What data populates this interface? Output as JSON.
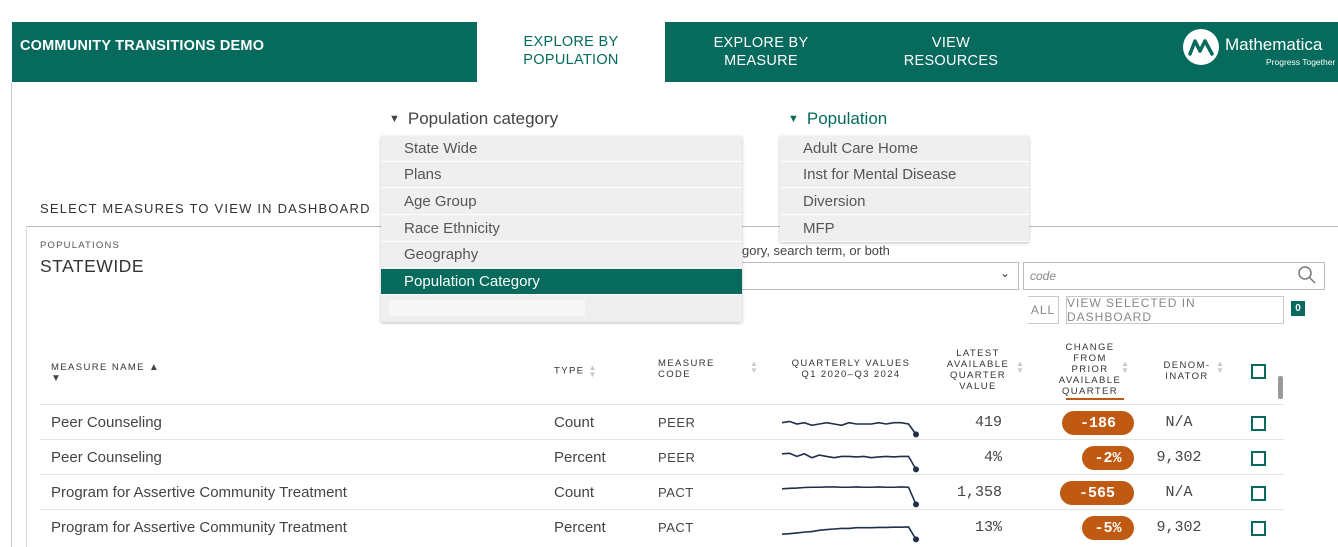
{
  "header": {
    "app_title": "COMMUNITY TRANSITIONS DEMO",
    "tabs": [
      {
        "label": "EXPLORE BY\nPOPULATION",
        "active": true
      },
      {
        "label": "EXPLORE BY\nMEASURE",
        "active": false
      },
      {
        "label": "VIEW\nRESOURCES",
        "active": false
      }
    ],
    "logo_name": "Mathematica",
    "logo_tagline": "Progress Together",
    "brand_color": "#066a5c"
  },
  "dropdowns": {
    "category": {
      "label": "Population category",
      "items": [
        "State Wide",
        "Plans",
        "Age Group",
        "Race Ethnicity",
        "Geography",
        "Population Category"
      ],
      "selected": "Population Category"
    },
    "population": {
      "label": "Population",
      "items": [
        "Adult Care Home",
        "Inst for Mental Disease",
        "Diversion",
        "MFP"
      ]
    }
  },
  "section": {
    "title": "SELECT MEASURES TO VIEW IN DASHBOARD",
    "populations_label": "POPULATIONS",
    "populations_value": "STATEWIDE",
    "filter_hint": "gory, search term, or both",
    "search_placeholder": "code",
    "clear_label": "ALL",
    "view_selected_label": "VIEW SELECTED IN DASHBOARD",
    "selected_count": "0"
  },
  "table": {
    "columns": {
      "measure_name": "MEASURE NAME",
      "type": "TYPE",
      "measure_code": "MEASURE\nCODE",
      "quarterly": "QUARTERLY VALUES\nQ1 2020–Q3 2024",
      "latest": "LATEST\nAVAILABLE\nQUARTER\nVALUE",
      "change": "CHANGE\nFROM\nPRIOR\nAVAILABLE\nQUARTER",
      "denominator": "DENOM-\nINATOR"
    },
    "rows": [
      {
        "name": "Peer Counseling",
        "type": "Count",
        "code": "PEER",
        "latest": "419",
        "change": "-186",
        "denominator": "N/A",
        "spark": [
          0.55,
          0.6,
          0.5,
          0.55,
          0.45,
          0.5,
          0.55,
          0.5,
          0.45,
          0.55,
          0.5,
          0.5,
          0.5,
          0.55,
          0.5,
          0.55,
          0.55,
          0.5,
          0.1
        ]
      },
      {
        "name": "Peer Counseling",
        "type": "Percent",
        "code": "PEER",
        "latest": "4%",
        "change": "-2%",
        "denominator": "9,302",
        "spark": [
          0.7,
          0.72,
          0.6,
          0.7,
          0.55,
          0.65,
          0.6,
          0.55,
          0.6,
          0.6,
          0.58,
          0.6,
          0.55,
          0.58,
          0.6,
          0.58,
          0.6,
          0.6,
          0.1
        ]
      },
      {
        "name": "Program for Assertive Community Treatment",
        "type": "Count",
        "code": "PACT",
        "latest": "1,358",
        "change": "-565",
        "denominator": "N/A",
        "spark": [
          0.7,
          0.72,
          0.73,
          0.75,
          0.76,
          0.76,
          0.77,
          0.77,
          0.76,
          0.76,
          0.77,
          0.76,
          0.76,
          0.77,
          0.76,
          0.76,
          0.77,
          0.76,
          0.1
        ]
      },
      {
        "name": "Program for Assertive Community Treatment",
        "type": "Percent",
        "code": "PACT",
        "latest": "13%",
        "change": "-5%",
        "denominator": "9,302",
        "spark": [
          0.3,
          0.32,
          0.35,
          0.38,
          0.4,
          0.45,
          0.48,
          0.5,
          0.52,
          0.52,
          0.55,
          0.55,
          0.55,
          0.56,
          0.56,
          0.57,
          0.57,
          0.58,
          0.1
        ]
      }
    ]
  }
}
